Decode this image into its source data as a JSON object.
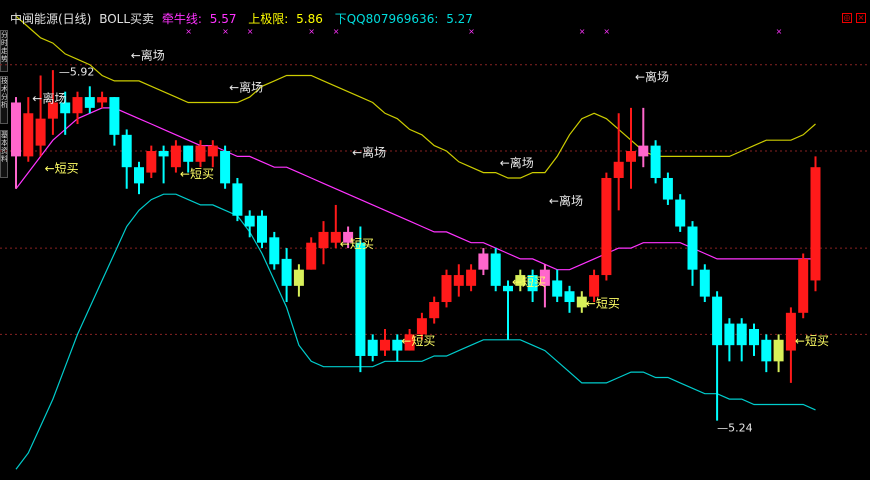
{
  "header": {
    "title": "中闽能源(日线)",
    "indicator": "BOLL买卖",
    "midline_label": "牵牛线:",
    "midline_value": "5.57",
    "upper_label": "上极限:",
    "upper_value": "5.86",
    "lower_label": "下QQ807969636:",
    "lower_value": "5.27"
  },
  "left_tabs": [
    "分时走势",
    "技术分析",
    "基本资料"
  ],
  "colors": {
    "up": "#ff1a1a",
    "down": "#00ffff",
    "pink": "#ff66cc",
    "yellow_fill": "#d8f05a",
    "mid": "#ff33ff",
    "upper": "#cccc00",
    "lower": "#00cccc",
    "grid": "#882222",
    "label": "#e8e8e8",
    "buy_label": "#ffff66"
  },
  "chart_data": {
    "type": "candlestick",
    "ylim": [
      5.16,
      6.05
    ],
    "high_marker": "5.92",
    "low_marker": "5.24",
    "candles": [
      {
        "o": 5.76,
        "c": 5.86,
        "h": 5.87,
        "l": 5.7,
        "k": "pink"
      },
      {
        "o": 5.84,
        "c": 5.76,
        "h": 5.87,
        "l": 5.75,
        "k": "up"
      },
      {
        "o": 5.78,
        "c": 5.83,
        "h": 5.91,
        "l": 5.76,
        "k": "up"
      },
      {
        "o": 5.83,
        "c": 5.86,
        "h": 5.92,
        "l": 5.8,
        "k": "up"
      },
      {
        "o": 5.86,
        "c": 5.84,
        "h": 5.88,
        "l": 5.8,
        "k": "down"
      },
      {
        "o": 5.84,
        "c": 5.87,
        "h": 5.88,
        "l": 5.82,
        "k": "up"
      },
      {
        "o": 5.85,
        "c": 5.87,
        "h": 5.89,
        "l": 5.84,
        "k": "down"
      },
      {
        "o": 5.86,
        "c": 5.87,
        "h": 5.88,
        "l": 5.85,
        "k": "up"
      },
      {
        "o": 5.87,
        "c": 5.8,
        "h": 5.87,
        "l": 5.78,
        "k": "down"
      },
      {
        "o": 5.8,
        "c": 5.74,
        "h": 5.81,
        "l": 5.7,
        "k": "down"
      },
      {
        "o": 5.74,
        "c": 5.71,
        "h": 5.75,
        "l": 5.69,
        "k": "down"
      },
      {
        "o": 5.73,
        "c": 5.77,
        "h": 5.78,
        "l": 5.72,
        "k": "up"
      },
      {
        "o": 5.77,
        "c": 5.76,
        "h": 5.78,
        "l": 5.71,
        "k": "down"
      },
      {
        "o": 5.74,
        "c": 5.78,
        "h": 5.79,
        "l": 5.73,
        "k": "up"
      },
      {
        "o": 5.78,
        "c": 5.75,
        "h": 5.78,
        "l": 5.73,
        "k": "down"
      },
      {
        "o": 5.75,
        "c": 5.78,
        "h": 5.79,
        "l": 5.74,
        "k": "up"
      },
      {
        "o": 5.78,
        "c": 5.76,
        "h": 5.79,
        "l": 5.74,
        "k": "up"
      },
      {
        "o": 5.77,
        "c": 5.71,
        "h": 5.78,
        "l": 5.7,
        "k": "down"
      },
      {
        "o": 5.71,
        "c": 5.65,
        "h": 5.72,
        "l": 5.64,
        "k": "down"
      },
      {
        "o": 5.65,
        "c": 5.63,
        "h": 5.66,
        "l": 5.61,
        "k": "down"
      },
      {
        "o": 5.65,
        "c": 5.6,
        "h": 5.66,
        "l": 5.59,
        "k": "down"
      },
      {
        "o": 5.61,
        "c": 5.56,
        "h": 5.62,
        "l": 5.55,
        "k": "down"
      },
      {
        "o": 5.57,
        "c": 5.52,
        "h": 5.59,
        "l": 5.49,
        "k": "down"
      },
      {
        "o": 5.52,
        "c": 5.55,
        "h": 5.56,
        "l": 5.5,
        "k": "yellow"
      },
      {
        "o": 5.55,
        "c": 5.6,
        "h": 5.61,
        "l": 5.55,
        "k": "up"
      },
      {
        "o": 5.59,
        "c": 5.62,
        "h": 5.64,
        "l": 5.56,
        "k": "up"
      },
      {
        "o": 5.6,
        "c": 5.62,
        "h": 5.67,
        "l": 5.59,
        "k": "up"
      },
      {
        "o": 5.62,
        "c": 5.6,
        "h": 5.63,
        "l": 5.59,
        "k": "pink"
      },
      {
        "o": 5.6,
        "c": 5.39,
        "h": 5.63,
        "l": 5.36,
        "k": "down"
      },
      {
        "o": 5.39,
        "c": 5.42,
        "h": 5.43,
        "l": 5.38,
        "k": "down"
      },
      {
        "o": 5.4,
        "c": 5.42,
        "h": 5.44,
        "l": 5.39,
        "k": "up"
      },
      {
        "o": 5.42,
        "c": 5.4,
        "h": 5.43,
        "l": 5.38,
        "k": "down"
      },
      {
        "o": 5.4,
        "c": 5.43,
        "h": 5.44,
        "l": 5.4,
        "k": "up"
      },
      {
        "o": 5.43,
        "c": 5.46,
        "h": 5.47,
        "l": 5.42,
        "k": "up"
      },
      {
        "o": 5.46,
        "c": 5.49,
        "h": 5.5,
        "l": 5.45,
        "k": "up"
      },
      {
        "o": 5.49,
        "c": 5.54,
        "h": 5.55,
        "l": 5.48,
        "k": "up"
      },
      {
        "o": 5.54,
        "c": 5.52,
        "h": 5.56,
        "l": 5.5,
        "k": "up"
      },
      {
        "o": 5.52,
        "c": 5.55,
        "h": 5.56,
        "l": 5.51,
        "k": "up"
      },
      {
        "o": 5.55,
        "c": 5.58,
        "h": 5.59,
        "l": 5.54,
        "k": "pink"
      },
      {
        "o": 5.58,
        "c": 5.52,
        "h": 5.59,
        "l": 5.51,
        "k": "down"
      },
      {
        "o": 5.52,
        "c": 5.51,
        "h": 5.53,
        "l": 5.42,
        "k": "down"
      },
      {
        "o": 5.52,
        "c": 5.54,
        "h": 5.55,
        "l": 5.51,
        "k": "yellow"
      },
      {
        "o": 5.54,
        "c": 5.51,
        "h": 5.55,
        "l": 5.49,
        "k": "down"
      },
      {
        "o": 5.52,
        "c": 5.55,
        "h": 5.56,
        "l": 5.48,
        "k": "pink"
      },
      {
        "o": 5.53,
        "c": 5.5,
        "h": 5.55,
        "l": 5.49,
        "k": "down"
      },
      {
        "o": 5.51,
        "c": 5.49,
        "h": 5.52,
        "l": 5.47,
        "k": "down"
      },
      {
        "o": 5.48,
        "c": 5.5,
        "h": 5.51,
        "l": 5.47,
        "k": "yellow"
      },
      {
        "o": 5.5,
        "c": 5.54,
        "h": 5.55,
        "l": 5.49,
        "k": "up"
      },
      {
        "o": 5.54,
        "c": 5.72,
        "h": 5.73,
        "l": 5.53,
        "k": "up"
      },
      {
        "o": 5.72,
        "c": 5.75,
        "h": 5.84,
        "l": 5.66,
        "k": "up"
      },
      {
        "o": 5.75,
        "c": 5.77,
        "h": 5.85,
        "l": 5.7,
        "k": "up"
      },
      {
        "o": 5.76,
        "c": 5.78,
        "h": 5.85,
        "l": 5.74,
        "k": "pink"
      },
      {
        "o": 5.78,
        "c": 5.72,
        "h": 5.79,
        "l": 5.71,
        "k": "down"
      },
      {
        "o": 5.72,
        "c": 5.68,
        "h": 5.73,
        "l": 5.67,
        "k": "down"
      },
      {
        "o": 5.68,
        "c": 5.63,
        "h": 5.69,
        "l": 5.62,
        "k": "down"
      },
      {
        "o": 5.63,
        "c": 5.55,
        "h": 5.64,
        "l": 5.52,
        "k": "down"
      },
      {
        "o": 5.55,
        "c": 5.5,
        "h": 5.56,
        "l": 5.49,
        "k": "down"
      },
      {
        "o": 5.5,
        "c": 5.41,
        "h": 5.51,
        "l": 5.27,
        "k": "down"
      },
      {
        "o": 5.41,
        "c": 5.45,
        "h": 5.46,
        "l": 5.38,
        "k": "down"
      },
      {
        "o": 5.45,
        "c": 5.41,
        "h": 5.46,
        "l": 5.38,
        "k": "down"
      },
      {
        "o": 5.41,
        "c": 5.44,
        "h": 5.45,
        "l": 5.39,
        "k": "down"
      },
      {
        "o": 5.42,
        "c": 5.38,
        "h": 5.43,
        "l": 5.36,
        "k": "down"
      },
      {
        "o": 5.38,
        "c": 5.42,
        "h": 5.43,
        "l": 5.36,
        "k": "yellow"
      },
      {
        "o": 5.4,
        "c": 5.47,
        "h": 5.48,
        "l": 5.34,
        "k": "up"
      },
      {
        "o": 5.47,
        "c": 5.57,
        "h": 5.58,
        "l": 5.46,
        "k": "up"
      },
      {
        "o": 5.53,
        "c": 5.74,
        "h": 5.76,
        "l": 5.51,
        "k": "up"
      }
    ],
    "mid_line": [
      5.7,
      5.73,
      5.76,
      5.79,
      5.81,
      5.83,
      5.84,
      5.85,
      5.85,
      5.84,
      5.83,
      5.82,
      5.81,
      5.8,
      5.79,
      5.78,
      5.78,
      5.77,
      5.76,
      5.76,
      5.75,
      5.74,
      5.74,
      5.73,
      5.72,
      5.71,
      5.7,
      5.69,
      5.68,
      5.67,
      5.66,
      5.65,
      5.64,
      5.63,
      5.62,
      5.62,
      5.61,
      5.6,
      5.6,
      5.59,
      5.58,
      5.57,
      5.57,
      5.56,
      5.55,
      5.55,
      5.56,
      5.57,
      5.58,
      5.59,
      5.59,
      5.6,
      5.6,
      5.6,
      5.6,
      5.59,
      5.58,
      5.57,
      5.57,
      5.57,
      5.57,
      5.57,
      5.57,
      5.57,
      5.57,
      5.57
    ],
    "upper_line": [
      6.02,
      6.0,
      5.98,
      5.97,
      5.95,
      5.94,
      5.93,
      5.91,
      5.9,
      5.9,
      5.9,
      5.89,
      5.88,
      5.87,
      5.86,
      5.86,
      5.86,
      5.86,
      5.86,
      5.87,
      5.89,
      5.9,
      5.91,
      5.91,
      5.91,
      5.9,
      5.89,
      5.88,
      5.87,
      5.86,
      5.84,
      5.83,
      5.81,
      5.8,
      5.78,
      5.77,
      5.75,
      5.74,
      5.73,
      5.73,
      5.72,
      5.72,
      5.73,
      5.73,
      5.76,
      5.8,
      5.83,
      5.84,
      5.83,
      5.81,
      5.79,
      5.77,
      5.76,
      5.76,
      5.76,
      5.76,
      5.76,
      5.76,
      5.76,
      5.77,
      5.78,
      5.79,
      5.79,
      5.79,
      5.8,
      5.82
    ],
    "lower_line": [
      5.18,
      5.21,
      5.26,
      5.31,
      5.37,
      5.43,
      5.48,
      5.53,
      5.58,
      5.63,
      5.66,
      5.68,
      5.69,
      5.69,
      5.68,
      5.67,
      5.67,
      5.66,
      5.65,
      5.62,
      5.58,
      5.53,
      5.48,
      5.41,
      5.38,
      5.37,
      5.37,
      5.37,
      5.37,
      5.37,
      5.38,
      5.38,
      5.38,
      5.38,
      5.39,
      5.39,
      5.4,
      5.41,
      5.42,
      5.42,
      5.42,
      5.42,
      5.41,
      5.4,
      5.38,
      5.36,
      5.34,
      5.34,
      5.34,
      5.35,
      5.36,
      5.36,
      5.35,
      5.35,
      5.34,
      5.33,
      5.32,
      5.32,
      5.31,
      5.31,
      5.3,
      5.3,
      5.3,
      5.3,
      5.3,
      5.29
    ],
    "annotations": [
      {
        "idx": 1,
        "text": "离场",
        "kind": "sell",
        "y": 5.86
      },
      {
        "idx": 9,
        "text": "离场",
        "kind": "sell",
        "y": 5.94
      },
      {
        "idx": 17,
        "text": "离场",
        "kind": "sell",
        "y": 5.88
      },
      {
        "idx": 27,
        "text": "离场",
        "kind": "sell",
        "y": 5.76
      },
      {
        "idx": 39,
        "text": "离场",
        "kind": "sell",
        "y": 5.74
      },
      {
        "idx": 43,
        "text": "离场",
        "kind": "sell",
        "y": 5.67
      },
      {
        "idx": 50,
        "text": "离场",
        "kind": "sell",
        "y": 5.9
      },
      {
        "idx": 2,
        "text": "短买",
        "kind": "buy",
        "y": 5.73
      },
      {
        "idx": 13,
        "text": "短买",
        "kind": "buy",
        "y": 5.72
      },
      {
        "idx": 26,
        "text": "短买",
        "kind": "buy",
        "y": 5.59
      },
      {
        "idx": 31,
        "text": "短买",
        "kind": "buy",
        "y": 5.41
      },
      {
        "idx": 40,
        "text": "短买",
        "kind": "buy",
        "y": 5.52
      },
      {
        "idx": 46,
        "text": "短买",
        "kind": "buy",
        "y": 5.48
      },
      {
        "idx": 63,
        "text": "短买",
        "kind": "buy",
        "y": 5.41
      }
    ],
    "top_marks": [
      14,
      17,
      19,
      24,
      26,
      37,
      46,
      48,
      62
    ],
    "grid_values": [
      5.93,
      5.77,
      5.59,
      5.43
    ]
  }
}
